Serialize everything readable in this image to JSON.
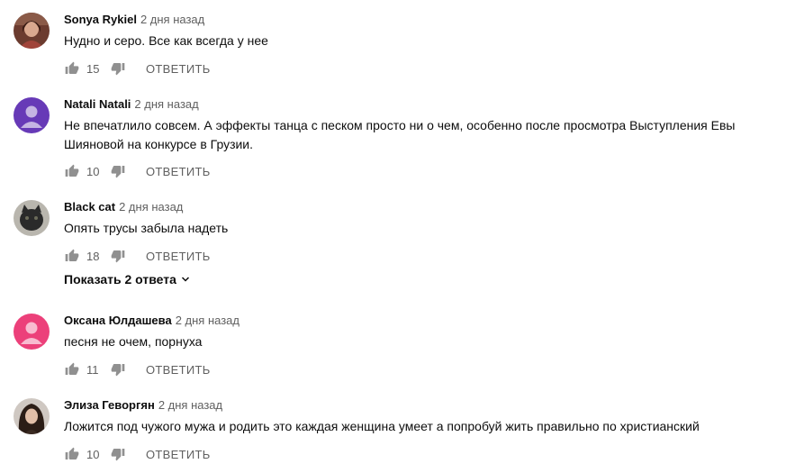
{
  "labels": {
    "reply": "ОТВЕТИТЬ"
  },
  "colors": {
    "accent_purple": "#673ab7",
    "accent_pink": "#ec407a",
    "text": "#0d0d0d",
    "meta": "#606060"
  },
  "comments": [
    {
      "author": "Sonya Rykiel",
      "time": "2 дня назад",
      "lines": [
        "Нудно и серо. Все как всегда у нее"
      ],
      "likes": "15",
      "avatar": "photo-woman-red-icon"
    },
    {
      "author": "Natali Natali",
      "time": "2 дня назад",
      "lines": [
        "Не впечатлило совсем.  А эффекты  танца с песком просто ни о чем, особенно после просмотра Выступления Евы",
        "Шияновой на конкурсе в Грузии."
      ],
      "likes": "10",
      "avatar": "default-user-purple-icon"
    },
    {
      "author": "Black cat",
      "time": "2 дня назад",
      "lines": [
        "Опять трусы забыла надеть"
      ],
      "likes": "18",
      "avatar": "photo-black-cat-icon",
      "show_replies": "Показать 2 ответа"
    },
    {
      "author": "Оксана Юлдашева",
      "time": "2 дня назад",
      "lines": [
        "песня не очем, порнуха"
      ],
      "likes": "11",
      "avatar": "default-user-pink-icon"
    },
    {
      "author": "Элиза Геворгян",
      "time": "2 дня назад",
      "lines": [
        "Ложится под чужого мужа и родить это каждая женщина умеет а попробуй жить правильно по христианский"
      ],
      "likes": "10",
      "avatar": "photo-woman-curly-icon"
    }
  ]
}
